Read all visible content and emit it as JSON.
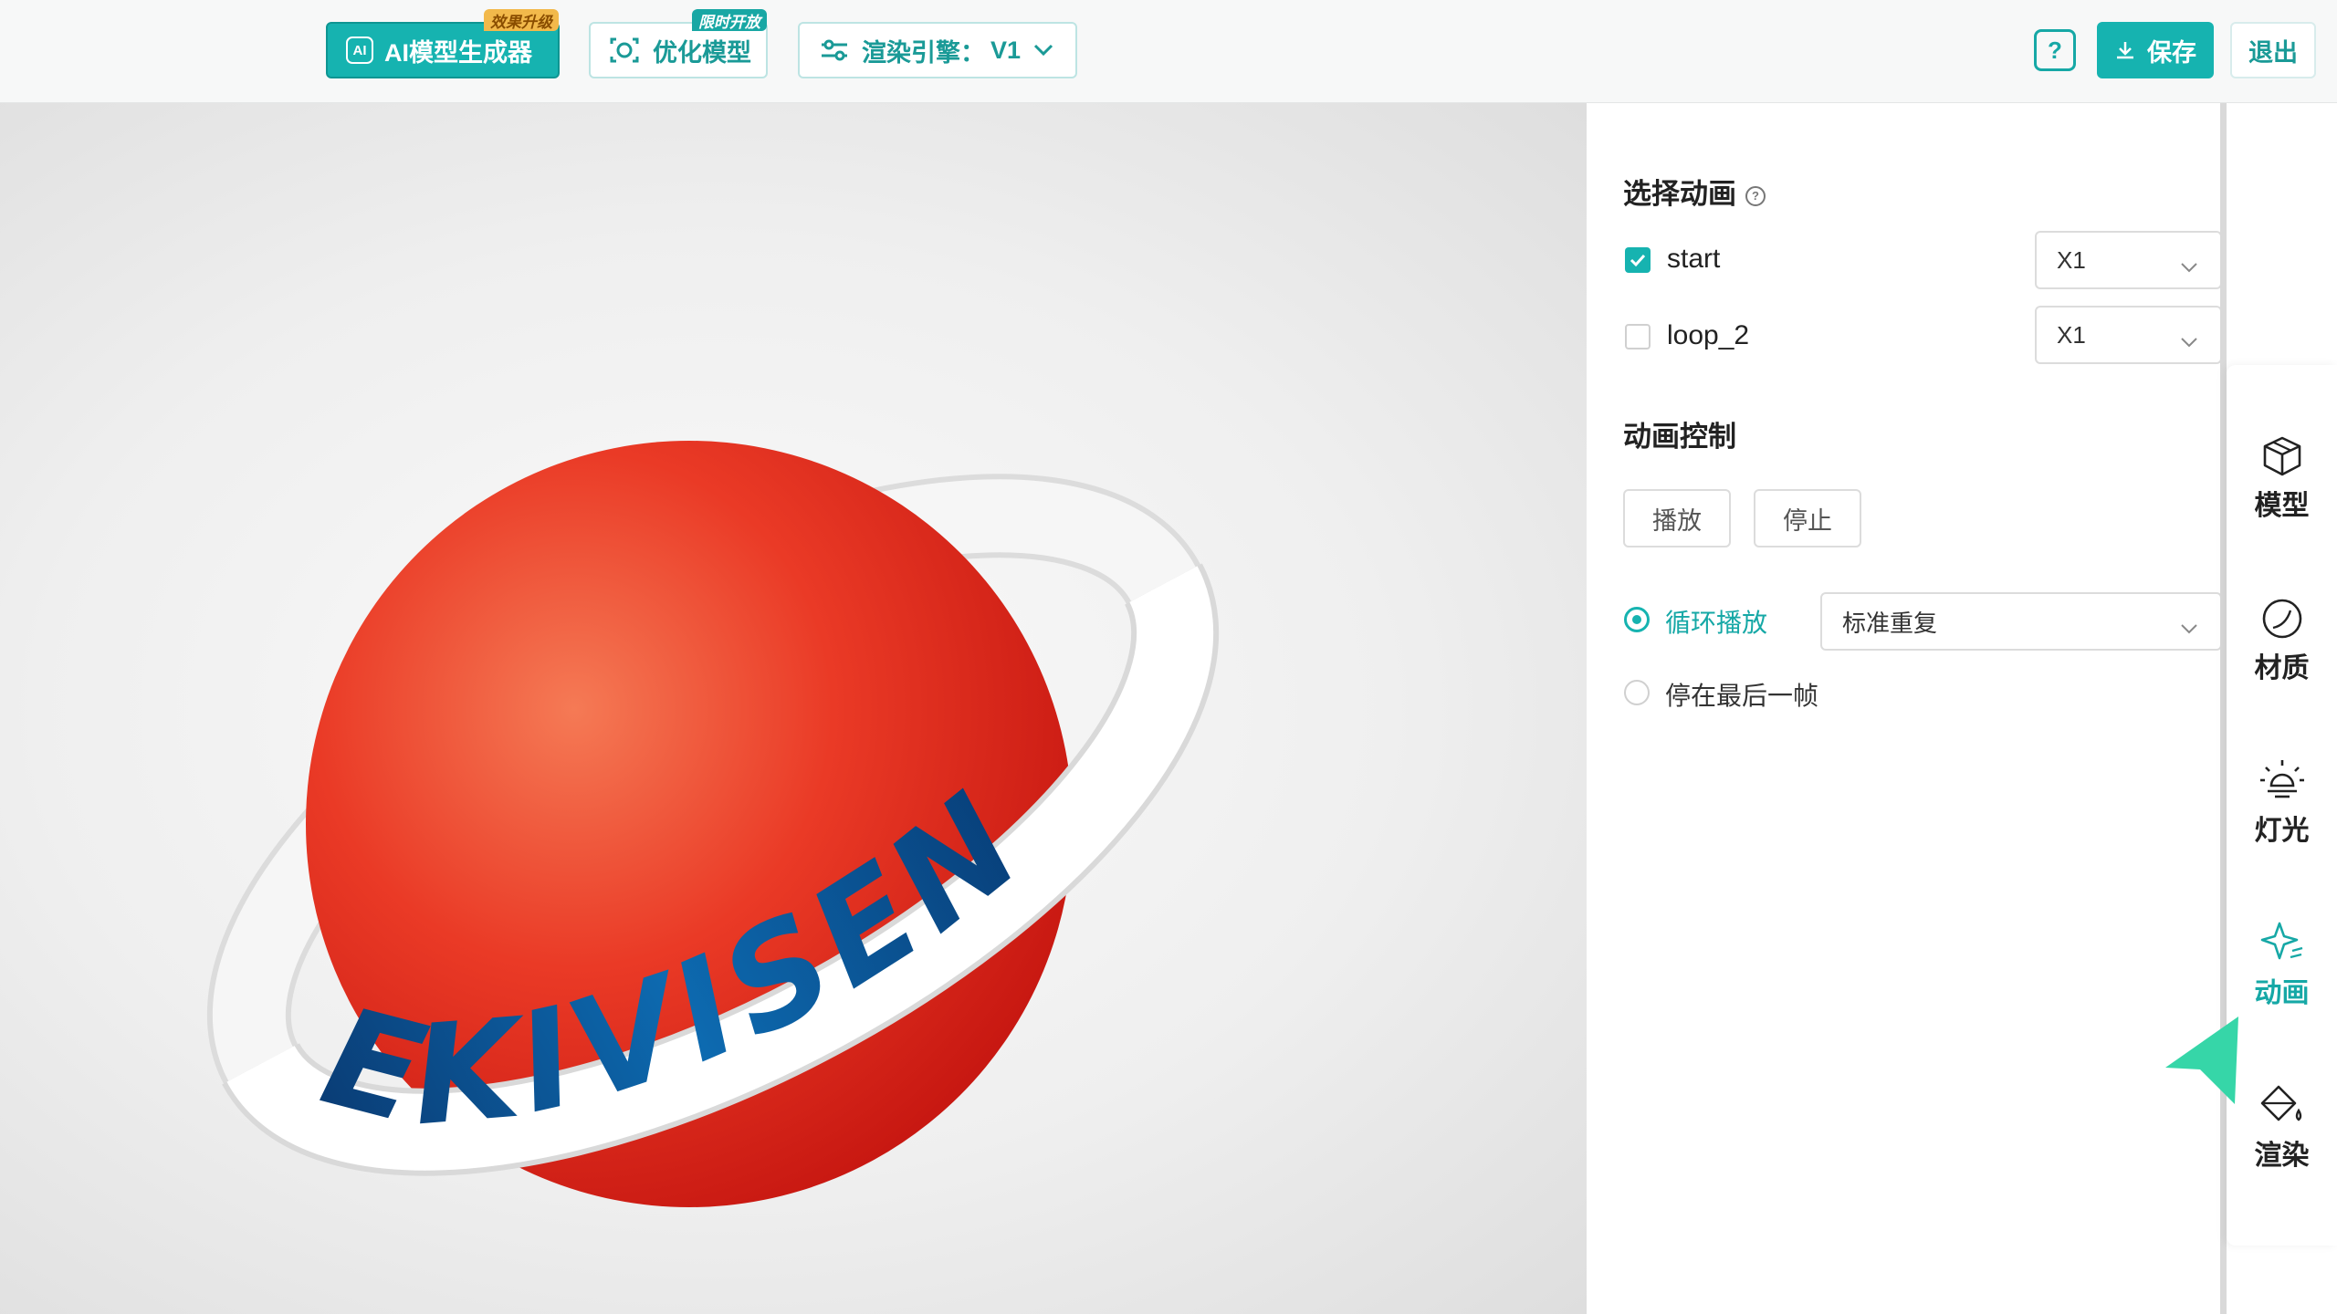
{
  "toolbar": {
    "ai_button": "AI模型生成器",
    "ai_badge": "效果升级",
    "optimize_button": "优化模型",
    "optimize_badge": "限时开放",
    "engine_label": "渲染引擎：",
    "engine_value": "V1",
    "help": "?",
    "save": "保存",
    "exit": "退出"
  },
  "model_text": "EKIVISEN",
  "panel": {
    "select_animation_title": "选择动画",
    "animations": [
      {
        "name": "start",
        "checked": true,
        "speed": "X1"
      },
      {
        "name": "loop_2",
        "checked": false,
        "speed": "X1"
      }
    ],
    "animation_control_title": "动画控制",
    "play_button": "播放",
    "stop_button": "停止",
    "loop_option": "循环播放",
    "loop_mode": "标准重复",
    "stop_last_frame_option": "停在最后一帧"
  },
  "sidenav": {
    "items": [
      {
        "label": "模型",
        "icon": "cube-icon"
      },
      {
        "label": "材质",
        "icon": "material-sphere-icon"
      },
      {
        "label": "灯光",
        "icon": "light-bulb-icon"
      },
      {
        "label": "动画",
        "icon": "sparkle-icon",
        "active": true
      },
      {
        "label": "渲染",
        "icon": "paint-bucket-icon"
      }
    ]
  },
  "colors": {
    "accent": "#16b3b0",
    "badge_orange": "#f2b94b",
    "sphere_red": "#e0221c",
    "ring_blue": "#0a5a9a"
  }
}
